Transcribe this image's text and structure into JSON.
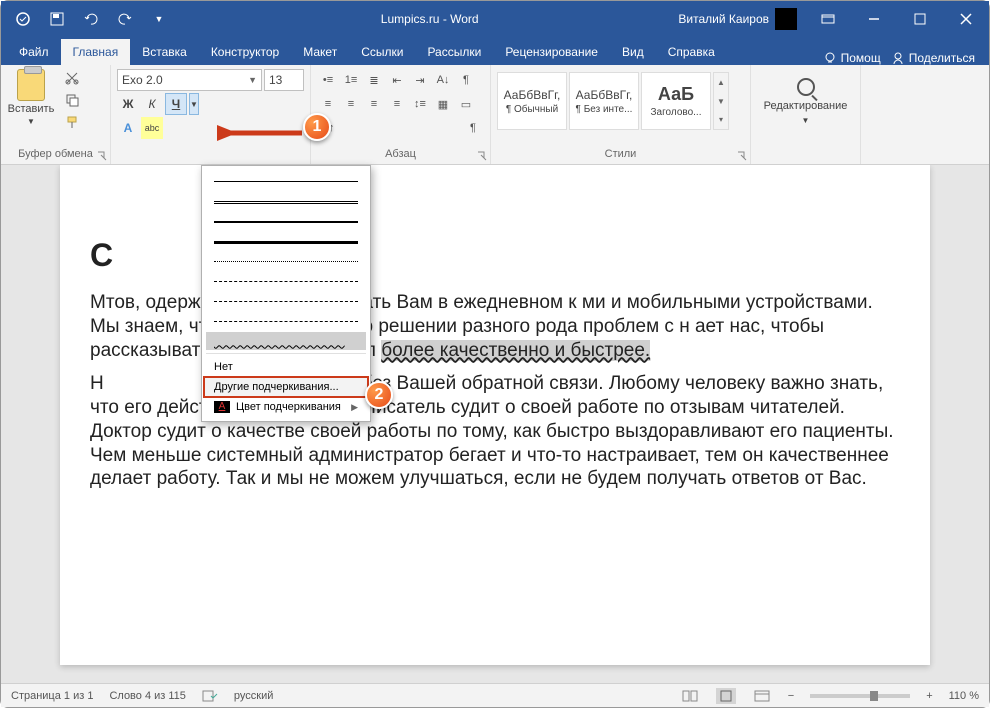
{
  "titlebar": {
    "title": "Lumpics.ru  -  Word",
    "user": "Виталий Каиров"
  },
  "tabs": {
    "file": "Файл",
    "home": "Главная",
    "insert": "Вставка",
    "design": "Конструктор",
    "layout": "Макет",
    "references": "Ссылки",
    "mailings": "Рассылки",
    "review": "Рецензирование",
    "view": "Вид",
    "help": "Справка",
    "assist": "Помощ",
    "share": "Поделиться"
  },
  "ribbon": {
    "clipboard": {
      "label": "Буфер обмена",
      "paste": "Вставить"
    },
    "font": {
      "name": "Exo 2.0",
      "size": "13",
      "bold": "Ж",
      "italic": "К",
      "underline": "Ч",
      "style_a": "A",
      "highlight": "abc"
    },
    "paragraph": {
      "label": "Абзац"
    },
    "styles": {
      "label": "Стили",
      "s1": {
        "sample": "АаБбВвГг,",
        "name": "¶ Обычный"
      },
      "s2": {
        "sample": "АаБбВвГг,",
        "name": "¶ Без инте..."
      },
      "s3": {
        "sample": "АаБ",
        "name": "Заголово..."
      }
    },
    "editing": {
      "label": "Редактирование"
    }
  },
  "underline_menu": {
    "none": "Нет",
    "other": "Другие подчеркивания...",
    "color": "Цвет подчеркивания"
  },
  "document": {
    "heading_fragment": "С",
    "p1_pre": "М",
    "p1_rest": "тов, одержимых идеей помогать Вам в ежедневном к                                               ми и мобильными устройствами. Мы знаем, что в и                                               нформации о решении разного рода проблем с н                                               ает нас, чтобы рассказывать Вам, как решать п                                               ",
    "p1_underlined": "более качественно и быстрее.",
    "p2_pre": "Н",
    "p2_rest": "елать без Вашей обратной связи. Любому человеку важно знать, что его действия правильные. Писатель судит о своей работе по отзывам читателей. Доктор судит о качестве своей работы по тому, как быстро выздоравливают его пациенты. Чем меньше системный администратор бегает и что-то настраивает, тем он качественнее делает работу. Так и мы не можем улучшаться, если не будем получать ответов от Вас."
  },
  "statusbar": {
    "page": "Страница 1 из 1",
    "words": "Слово 4 из 115",
    "lang": "русский",
    "zoom": "110 %"
  },
  "callouts": {
    "c1": "1",
    "c2": "2"
  }
}
